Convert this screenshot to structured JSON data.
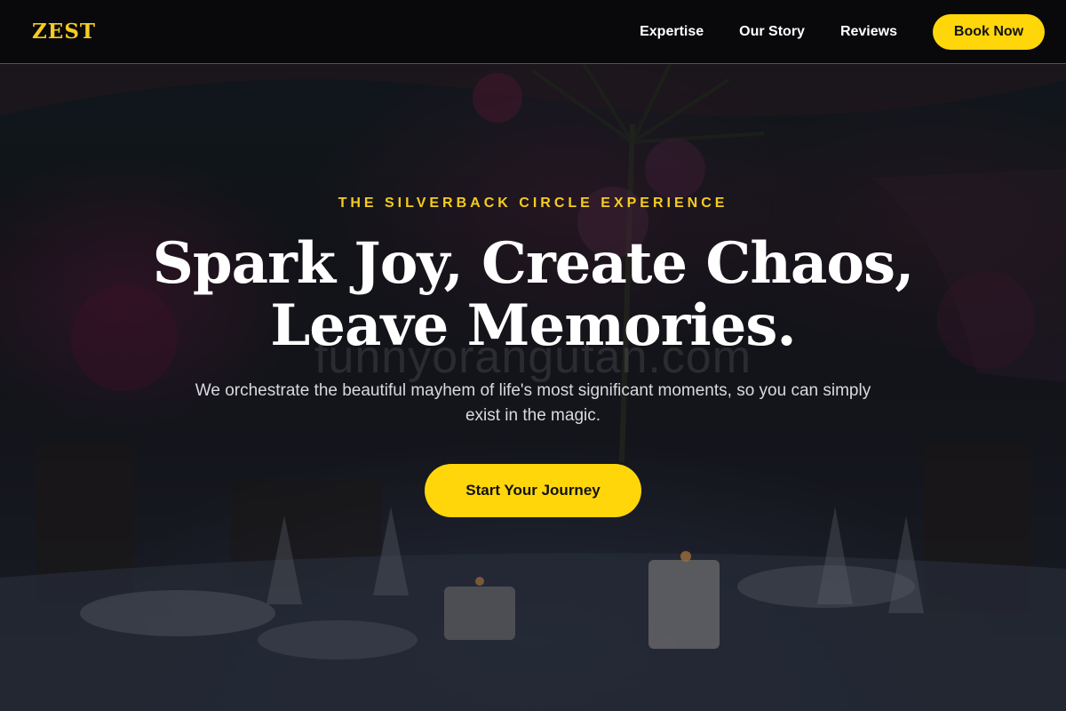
{
  "header": {
    "brand": "ZEST",
    "nav": [
      {
        "label": "Expertise"
      },
      {
        "label": "Our Story"
      },
      {
        "label": "Reviews"
      }
    ],
    "cta_label": "Book Now"
  },
  "hero": {
    "eyebrow": "THE SILVERBACK CIRCLE EXPERIENCE",
    "title_line1": "Spark Joy, Create Chaos,",
    "title_line2": "Leave Memories.",
    "subtitle": "We orchestrate the beautiful mayhem of life's most significant moments, so you can simply exist in the magic.",
    "cta_label": "Start Your Journey",
    "watermark": "funnyorangutan.com"
  },
  "colors": {
    "accent": "#ffd60a",
    "brand": "#f5cc1f",
    "header_bg": "#080808"
  },
  "icons": {
    "background": "banquet-table-photo"
  }
}
